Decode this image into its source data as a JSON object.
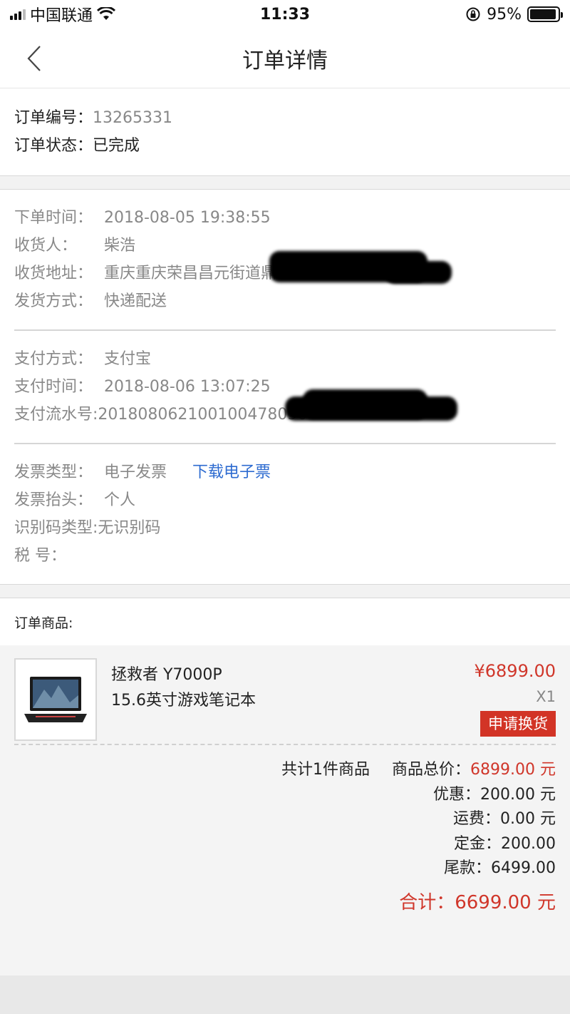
{
  "status_bar": {
    "carrier": "中国联通",
    "time": "11:33",
    "battery": "95%",
    "battery_level": 0.95
  },
  "nav": {
    "title": "订单详情"
  },
  "order": {
    "number_label": "订单编号：",
    "number": "13265331",
    "status_label": "订单状态：",
    "status": "已完成"
  },
  "delivery": {
    "time_label": "下单时间：",
    "time": "2018-08-05 19:38:55",
    "receiver_label": "收货人：",
    "receiver": "柴浩",
    "address_label": "收货地址：",
    "address": "重庆重庆荣昌昌元街道鼎",
    "method_label": "发货方式：",
    "method": "快递配送"
  },
  "payment": {
    "method_label": "支付方式：",
    "method": "支付宝",
    "time_label": "支付时间：",
    "time": "2018-08-06 13:07:25",
    "serial_label": "支付流水号",
    "serial": ":201808062100100478050"
  },
  "invoice": {
    "type_label": "发票类型：",
    "type": "电子发票",
    "download": "下载电子票",
    "title_label": "发票抬头：",
    "title": "个人",
    "idtype_label": "识别码类型",
    "idtype": ":无识别码",
    "tax_label": "税 号："
  },
  "products": {
    "header": "订单商品:",
    "items": [
      {
        "name": "拯救者 Y7000P",
        "desc": "15.6英寸游戏笔记本",
        "price": "¥6899.00",
        "qty": "X1",
        "action": "申请换货"
      }
    ]
  },
  "summary": {
    "count": "共计1件商品",
    "subtotal_label": "商品总价：",
    "subtotal": "6899.00 元",
    "discount": "优惠：200.00 元",
    "shipping": "运费：0.00 元",
    "deposit": "定金：200.00",
    "balance": "尾款：6499.00",
    "total": "合计：6699.00 元"
  }
}
